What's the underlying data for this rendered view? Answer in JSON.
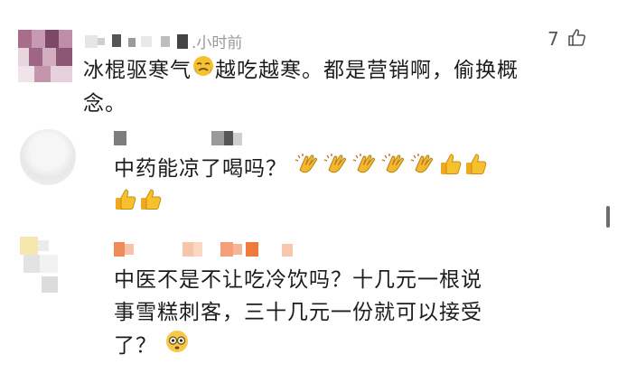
{
  "comments": [
    {
      "time": ".小时前",
      "likes": "7",
      "text_line1": "冰棍驱寒气",
      "text_line1b": "越吃越寒。都是营销啊，偷换概",
      "text_line2": "念。"
    },
    {
      "text": "中药能凉了喝吗？"
    },
    {
      "text_line1": "中医不是不让吃冷饮吗？十几元一根说",
      "text_line2": "事雪糕刺客，三十几元一份就可以接受",
      "text_line3": "了？"
    }
  ],
  "icons": {
    "like": "thumbs-up-outline-icon",
    "crying": "crying-face-emoji",
    "clap": "clapping-hands-emoji",
    "thumbs": "thumbs-up-emoji",
    "flushed": "flushed-face-emoji"
  },
  "colors": {
    "text": "#1c1c1c",
    "meta": "#9a9a9a",
    "emoji": "#f5b82a"
  }
}
